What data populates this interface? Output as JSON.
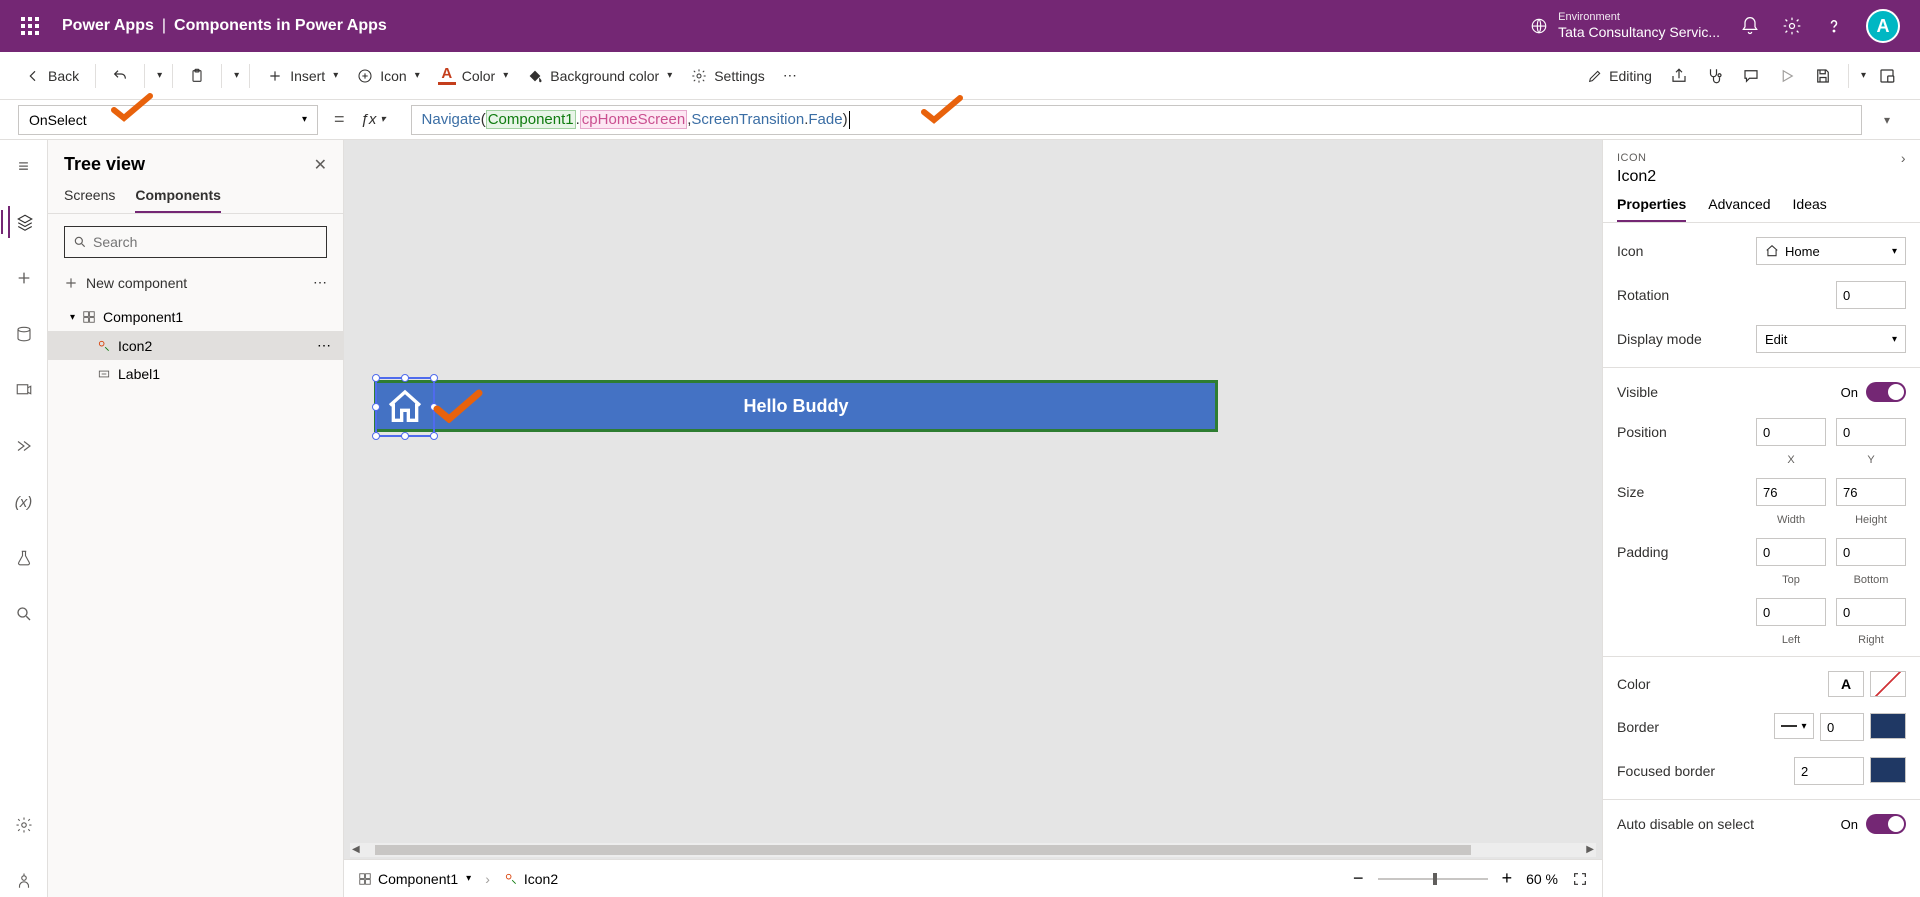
{
  "header": {
    "app_name": "Power Apps",
    "subtitle": "Components in Power Apps",
    "env_label": "Environment",
    "env_name": "Tata Consultancy Servic...",
    "avatar_letter": "A"
  },
  "ribbon": {
    "back": "Back",
    "insert": "Insert",
    "icon": "Icon",
    "color": "Color",
    "bgcolor": "Background color",
    "settings": "Settings",
    "editing": "Editing"
  },
  "formula": {
    "property": "OnSelect",
    "fn": "Navigate",
    "open": "(",
    "comp": "Component1",
    "dot1": ".",
    "prop": "cpHomeScreen",
    "comma": ", ",
    "enum": "ScreenTransition",
    "dot2": ".",
    "member": "Fade",
    "close": ")"
  },
  "tree": {
    "title": "Tree view",
    "tab_screens": "Screens",
    "tab_components": "Components",
    "search_ph": "Search",
    "new_component": "New component",
    "component_name": "Component1",
    "icon_name": "Icon2",
    "label_name": "Label1"
  },
  "canvas": {
    "label_text": "Hello Buddy",
    "status_component": "Component1",
    "status_icon": "Icon2",
    "zoom": "60 %"
  },
  "props": {
    "type": "ICON",
    "name": "Icon2",
    "tab_props": "Properties",
    "tab_adv": "Advanced",
    "tab_ideas": "Ideas",
    "icon_lbl": "Icon",
    "icon_val": "Home",
    "rotation_lbl": "Rotation",
    "rotation_val": "0",
    "display_lbl": "Display mode",
    "display_val": "Edit",
    "visible_lbl": "Visible",
    "visible_on": "On",
    "position_lbl": "Position",
    "pos_x": "0",
    "pos_y": "0",
    "x_lbl": "X",
    "y_lbl": "Y",
    "size_lbl": "Size",
    "size_w": "76",
    "size_h": "76",
    "w_lbl": "Width",
    "h_lbl": "Height",
    "padding_lbl": "Padding",
    "pad_t": "0",
    "pad_b": "0",
    "pad_l": "0",
    "pad_r": "0",
    "top_lbl": "Top",
    "bottom_lbl": "Bottom",
    "left_lbl": "Left",
    "right_lbl": "Right",
    "color_lbl": "Color",
    "border_lbl": "Border",
    "border_val": "0",
    "focused_lbl": "Focused border",
    "focused_val": "2",
    "auto_lbl": "Auto disable on select",
    "auto_on": "On",
    "border_color": "#1f3864",
    "focused_color": "#1f3864"
  }
}
